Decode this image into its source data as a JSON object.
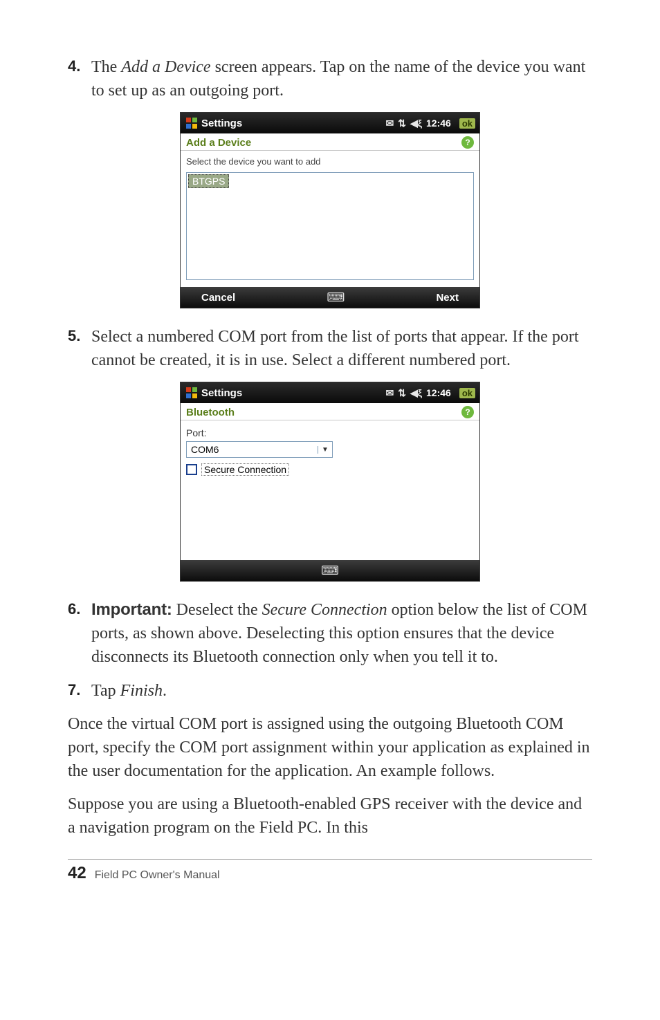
{
  "steps": {
    "four": {
      "num": "4.",
      "txt_pre": "The ",
      "txt_italic": "Add a Device",
      "txt_post": " screen appears. Tap on the name of the device you want to set up as an outgoing port."
    },
    "five": {
      "num": "5.",
      "txt": "Select a numbered COM port from the list of ports that appear. If the port cannot be created, it is in use. Select a different numbered port."
    },
    "six": {
      "num": "6.",
      "bold": "Important:",
      "txt_a": "  Deselect the ",
      "txt_italic": "Secure Connection",
      "txt_b": " option below the list of COM ports, as shown above. Deselecting this option ensures that the device disconnects its Bluetooth connection only when you tell it to."
    },
    "seven": {
      "num": "7.",
      "txt_a": "Tap ",
      "txt_italic": "Finish",
      "txt_b": "."
    }
  },
  "para1": "Once the virtual COM port is assigned using the outgoing Bluetooth COM port, specify the COM port assignment within your application as explained in the user documentation for the application. An example follows.",
  "para2": "Suppose you are using a Bluetooth-enabled GPS receiver with the device and a navigation program on the Field PC. In this",
  "shot1": {
    "taskbar_title": "Settings",
    "time": "12:46",
    "ok": "ok",
    "subheader": "Add a Device",
    "help": "?",
    "hint": "Select the device you want to add",
    "selected_item": "BTGPS",
    "sk_left": "Cancel",
    "sk_right": "Next"
  },
  "shot2": {
    "taskbar_title": "Settings",
    "time": "12:46",
    "ok": "ok",
    "subheader": "Bluetooth",
    "help": "?",
    "port_label": "Port:",
    "combo_value": "COM6",
    "chk_label": "Secure Connection"
  },
  "footer": {
    "page_num": "42",
    "book": "Field PC Owner's Manual"
  }
}
